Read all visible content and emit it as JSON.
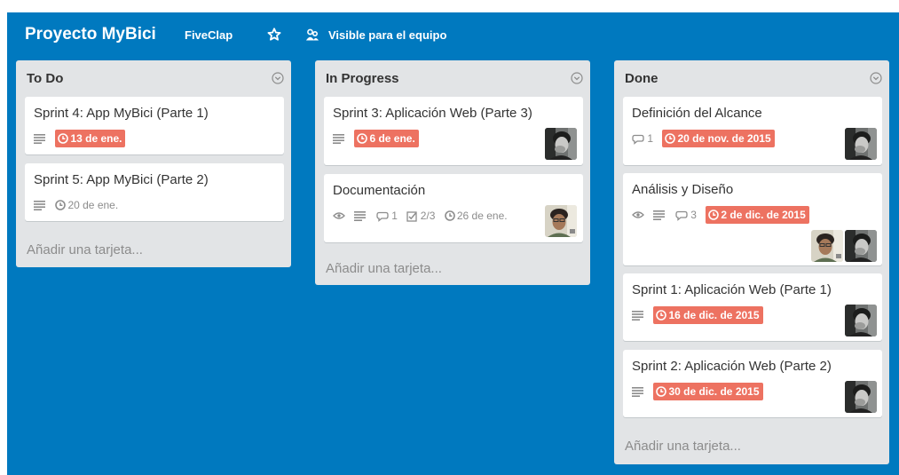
{
  "header": {
    "board_title": "Proyecto MyBici",
    "team": "FiveClap",
    "visibility": "Visible para el equipo"
  },
  "lists": [
    {
      "title": "To Do",
      "cards": [
        {
          "title": "Sprint 4: App MyBici (Parte 1)",
          "due": "13 de ene."
        },
        {
          "title": "Sprint 5: App MyBici (Parte 2)",
          "due": "20 de ene."
        }
      ],
      "add_card": "Añadir una tarjeta..."
    },
    {
      "title": "In Progress",
      "cards": [
        {
          "title": "Sprint 3: Aplicación Web (Parte 3)",
          "due": "6 de ene."
        },
        {
          "title": "Documentación",
          "comments": "1",
          "checklist": "2/3",
          "due": "26 de ene."
        }
      ],
      "add_card": "Añadir una tarjeta..."
    },
    {
      "title": "Done",
      "cards": [
        {
          "title": "Definición del Alcance",
          "comments": "1",
          "due": "20 de nov. de 2015"
        },
        {
          "title": "Análisis y Diseño",
          "comments": "3",
          "due": "2 de dic. de 2015"
        },
        {
          "title": "Sprint 1: Aplicación Web (Parte 1)",
          "due": "16 de dic. de 2015"
        },
        {
          "title": "Sprint 2: Aplicación Web (Parte 2)",
          "due": "30 de dic. de 2015"
        }
      ],
      "add_card": "Añadir una tarjeta..."
    }
  ],
  "colors": {
    "board_bg": "#0079bf",
    "list_bg": "#e2e4e6",
    "overdue": "#eb5a46"
  }
}
